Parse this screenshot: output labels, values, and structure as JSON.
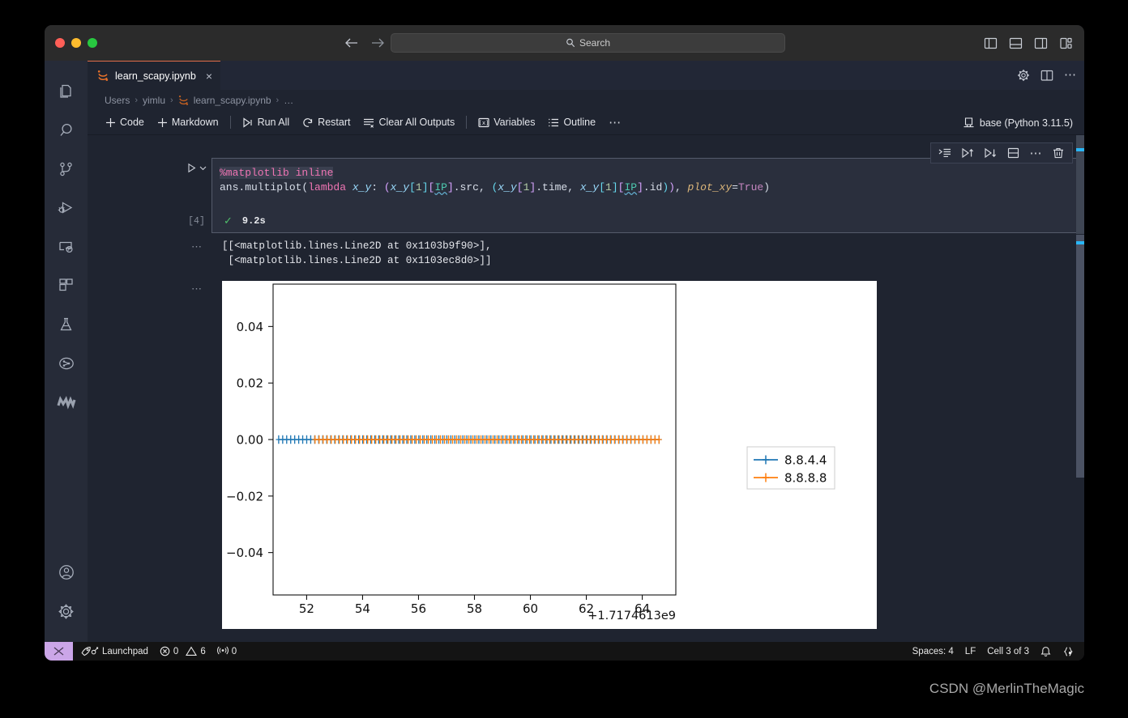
{
  "titlebar": {
    "search_placeholder": "Search",
    "back_icon": "arrow-left-icon",
    "forward_icon": "arrow-right-icon",
    "search_icon": "search-icon",
    "layout_icons": [
      "toggle-primary-sidebar-icon",
      "toggle-panel-icon",
      "toggle-secondary-sidebar-icon",
      "customize-layout-icon"
    ]
  },
  "tab": {
    "label": "learn_scapy.ipynb",
    "close_label": "×",
    "file_icon": "jupyter-icon",
    "actions": [
      "gear-icon",
      "split-editor-icon",
      "more-actions-icon"
    ]
  },
  "breadcrumb": {
    "items": [
      "Users",
      "yimlu",
      "learn_scapy.ipynb",
      "…"
    ],
    "separator": "›",
    "file_icon": "jupyter-icon"
  },
  "notebook_toolbar": {
    "items": [
      {
        "label": "Code",
        "icon": "plus-icon"
      },
      {
        "label": "Markdown",
        "icon": "plus-icon"
      },
      {
        "label": "Run All",
        "icon": "run-all-icon"
      },
      {
        "label": "Restart",
        "icon": "restart-icon"
      },
      {
        "label": "Clear All Outputs",
        "icon": "clear-outputs-icon"
      },
      {
        "label": "Variables",
        "icon": "variables-icon"
      },
      {
        "label": "Outline",
        "icon": "outline-icon"
      },
      {
        "label": "⋯",
        "icon": "more-icon"
      }
    ],
    "kernel": {
      "label": "base (Python 3.11.5)",
      "icon": "kernel-icon"
    }
  },
  "cell_toolbar": {
    "buttons": [
      "run-by-line-icon",
      "execute-above-cells-icon",
      "execute-cell-and-below-icon",
      "split-cell-icon",
      "more-actions-icon",
      "delete-cell-icon"
    ]
  },
  "cell": {
    "execution_count": "[4]",
    "run_icon": "run-cell-icon",
    "chevron_icon": "chevron-down-icon",
    "status_icon": "success-check-icon",
    "duration": "9.2s",
    "language": "Python",
    "code_line1": "%matplotlib inline",
    "code_line2_plain": "ans.multiplot(lambda x_y: (x_y[1][IP].src, (x_y[1].time, x_y[1][IP].id)), plot_xy=True)",
    "tokens": {
      "magic": "%matplotlib inline",
      "name": "ans.multiplot(",
      "lambda": "lambda",
      "arg": "x_y",
      "colon": ":",
      "ip": "IP",
      "src": ".src",
      "time": ".time",
      "id": ".id",
      "kwarg": "plot_xy",
      "kwval": "True"
    }
  },
  "output_text": {
    "dots": "⋯",
    "line1": "[[<matplotlib.lines.Line2D at 0x1103b9f90>],",
    "line2": " [<matplotlib.lines.Line2D at 0x1103ec8d0>]]"
  },
  "plot_output": {
    "dots": "⋯"
  },
  "chart_data": {
    "type": "line",
    "title": "",
    "xlabel": "",
    "ylabel": "",
    "x_offset_label": "+1.7174613e9",
    "xticks": [
      "52",
      "54",
      "56",
      "58",
      "60",
      "62",
      "64"
    ],
    "xtick_values": [
      52,
      54,
      56,
      58,
      60,
      62,
      64
    ],
    "yticks": [
      "0.04",
      "0.02",
      "0.00",
      "−0.02",
      "−0.04"
    ],
    "ytick_values": [
      0.04,
      0.02,
      0.0,
      -0.02,
      -0.04
    ],
    "xlim": [
      50.8,
      65.2
    ],
    "ylim": [
      -0.055,
      0.055
    ],
    "grid": false,
    "legend_position": "center right",
    "marker": "+",
    "series": [
      {
        "name": "8.8.4.4",
        "color": "#1f77b4",
        "y_constant": 0.0,
        "x_start": 51.0,
        "x_end": 64.6,
        "n_points": 96
      },
      {
        "name": "8.8.8.8",
        "color": "#ff7f0e",
        "y_constant": 0.0,
        "x_start": 52.3,
        "x_end": 64.6,
        "n_points": 86
      }
    ]
  },
  "activitybar": {
    "items": [
      {
        "name": "explorer",
        "icon": "files-icon"
      },
      {
        "name": "search",
        "icon": "search-icon"
      },
      {
        "name": "source-control",
        "icon": "source-control-icon"
      },
      {
        "name": "run-and-debug",
        "icon": "run-debug-icon"
      },
      {
        "name": "remote-explorer",
        "icon": "remote-explorer-icon"
      },
      {
        "name": "extensions",
        "icon": "extensions-icon"
      },
      {
        "name": "testing",
        "icon": "flask-icon"
      },
      {
        "name": "graph-view",
        "icon": "graph-circle-icon"
      },
      {
        "name": "marscode",
        "icon": "m-logo-icon"
      }
    ],
    "bottom": [
      {
        "name": "accounts",
        "icon": "account-icon"
      },
      {
        "name": "manage-settings",
        "icon": "gear-icon"
      }
    ]
  },
  "statusbar": {
    "remote_icon": "remote-indicator-icon",
    "left": [
      {
        "label": "Launchpad",
        "icon": "rocket-icon"
      },
      {
        "label": "0",
        "icon": "error-icon",
        "second_label": "6",
        "second_icon": "warning-icon"
      },
      {
        "label": "0",
        "icon": "radio-tower-icon"
      }
    ],
    "launchpad_label": "Launchpad",
    "errors": "0",
    "warnings": "6",
    "ports": "0",
    "right": [
      {
        "label": "Spaces: 4"
      },
      {
        "label": "LF"
      },
      {
        "label": "Cell 3 of 3"
      }
    ],
    "bell_icon": "bell-icon",
    "braces_icon": "braces-icon"
  },
  "watermark": {
    "text": "CSDN @MerlinTheMagic"
  },
  "colors": {
    "accent_blue": "#1f77b4",
    "accent_orange": "#ff7f0e",
    "tab_active_border": "#e06c4a",
    "remote_badge": "#cba6e8",
    "success_green": "#4fbf6a"
  }
}
